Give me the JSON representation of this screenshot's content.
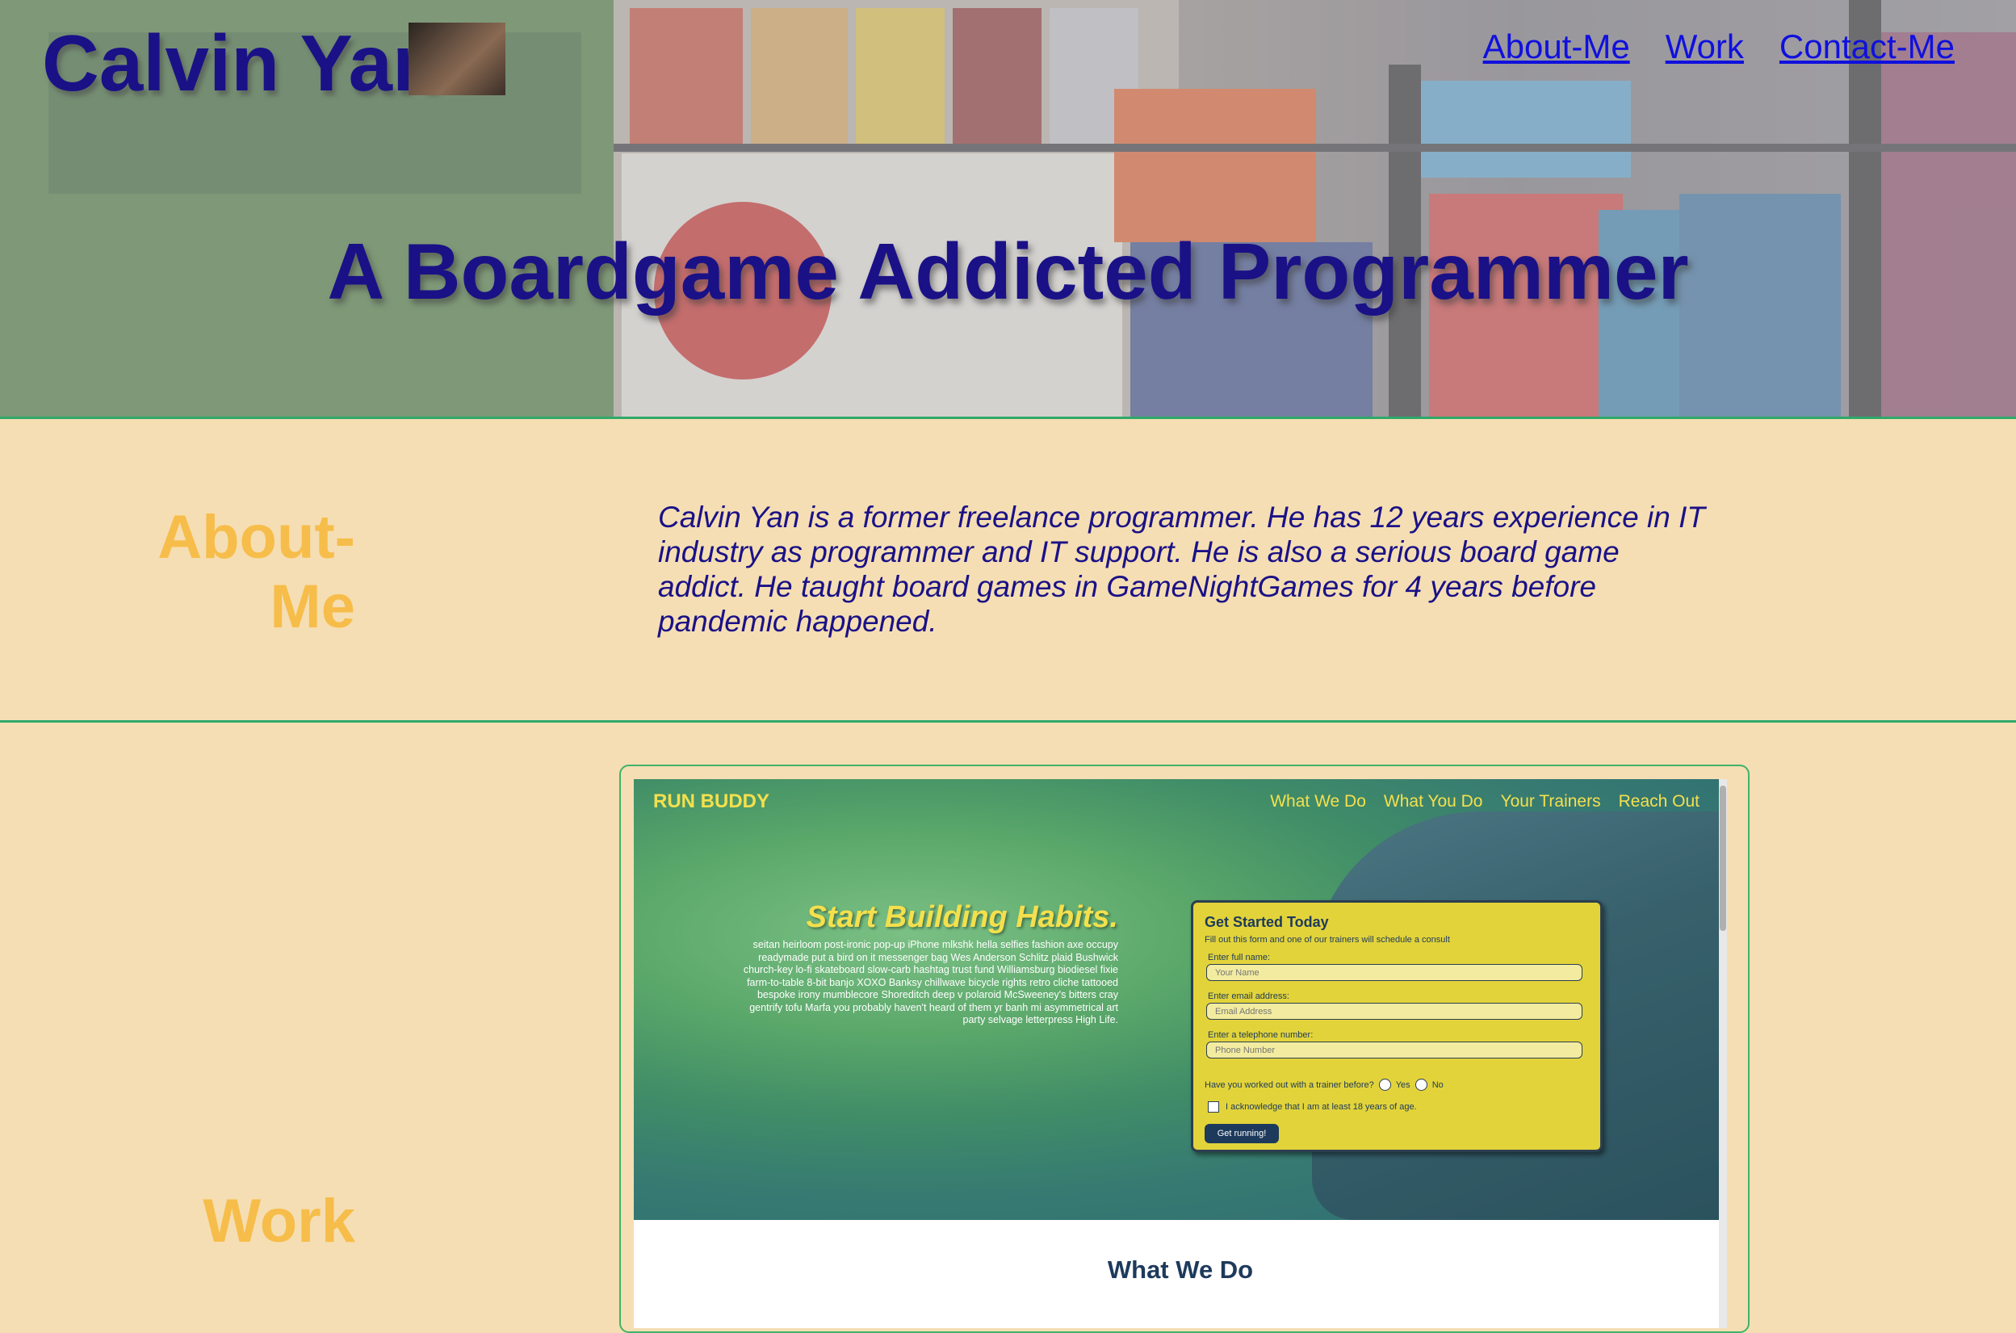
{
  "header": {
    "name": "Calvin Yan",
    "nav": [
      "About-Me",
      "Work",
      "Contact-Me"
    ],
    "tagline": "A Boardgame Addicted Programmer"
  },
  "about": {
    "title": "About-Me",
    "text": "Calvin Yan is a former freelance programmer. He has 12 years experience in IT industry as programmer and IT support. He is also a serious board game addict. He taught board games in GameNightGames for 4 years before pandemic happened."
  },
  "work": {
    "title": "Work",
    "project": {
      "logo": "RUN BUDDY",
      "nav": [
        "What We Do",
        "What You Do",
        "Your Trainers",
        "Reach Out"
      ],
      "headline": "Start Building Habits.",
      "blurb": "seitan heirloom post-ironic pop-up iPhone mlkshk hella selfies fashion axe occupy readymade put a bird on it messenger bag Wes Anderson Schlitz plaid Bushwick church-key lo-fi skateboard slow-carb hashtag trust fund Williamsburg biodiesel fixie farm-to-table 8-bit banjo XOXO Banksy chillwave bicycle rights retro cliche tattooed bespoke irony mumblecore Shoreditch deep v polaroid McSweeney's bitters cray gentrify tofu Marfa you probably haven't heard of them yr banh mi asymmetrical art party selvage letterpress High Life.",
      "form": {
        "title": "Get Started Today",
        "subtitle": "Fill out this form and one of our trainers will schedule a consult",
        "name_label": "Enter full name:",
        "name_placeholder": "Your Name",
        "email_label": "Enter email address:",
        "email_placeholder": "Email Address",
        "phone_label": "Enter a telephone number:",
        "phone_placeholder": "Phone Number",
        "question": "Have you worked out with a trainer before?",
        "yes": "Yes",
        "no": "No",
        "acknowledge": "I acknowledge that I am at least 18 years of age.",
        "button": "Get running!"
      },
      "section_title": "What We Do"
    }
  },
  "colors": {
    "accent_text": "#1a1187",
    "section_title": "#f7bd4a",
    "background": "#f5deb3",
    "divider": "#2fa86a",
    "link": "#1010dd"
  }
}
